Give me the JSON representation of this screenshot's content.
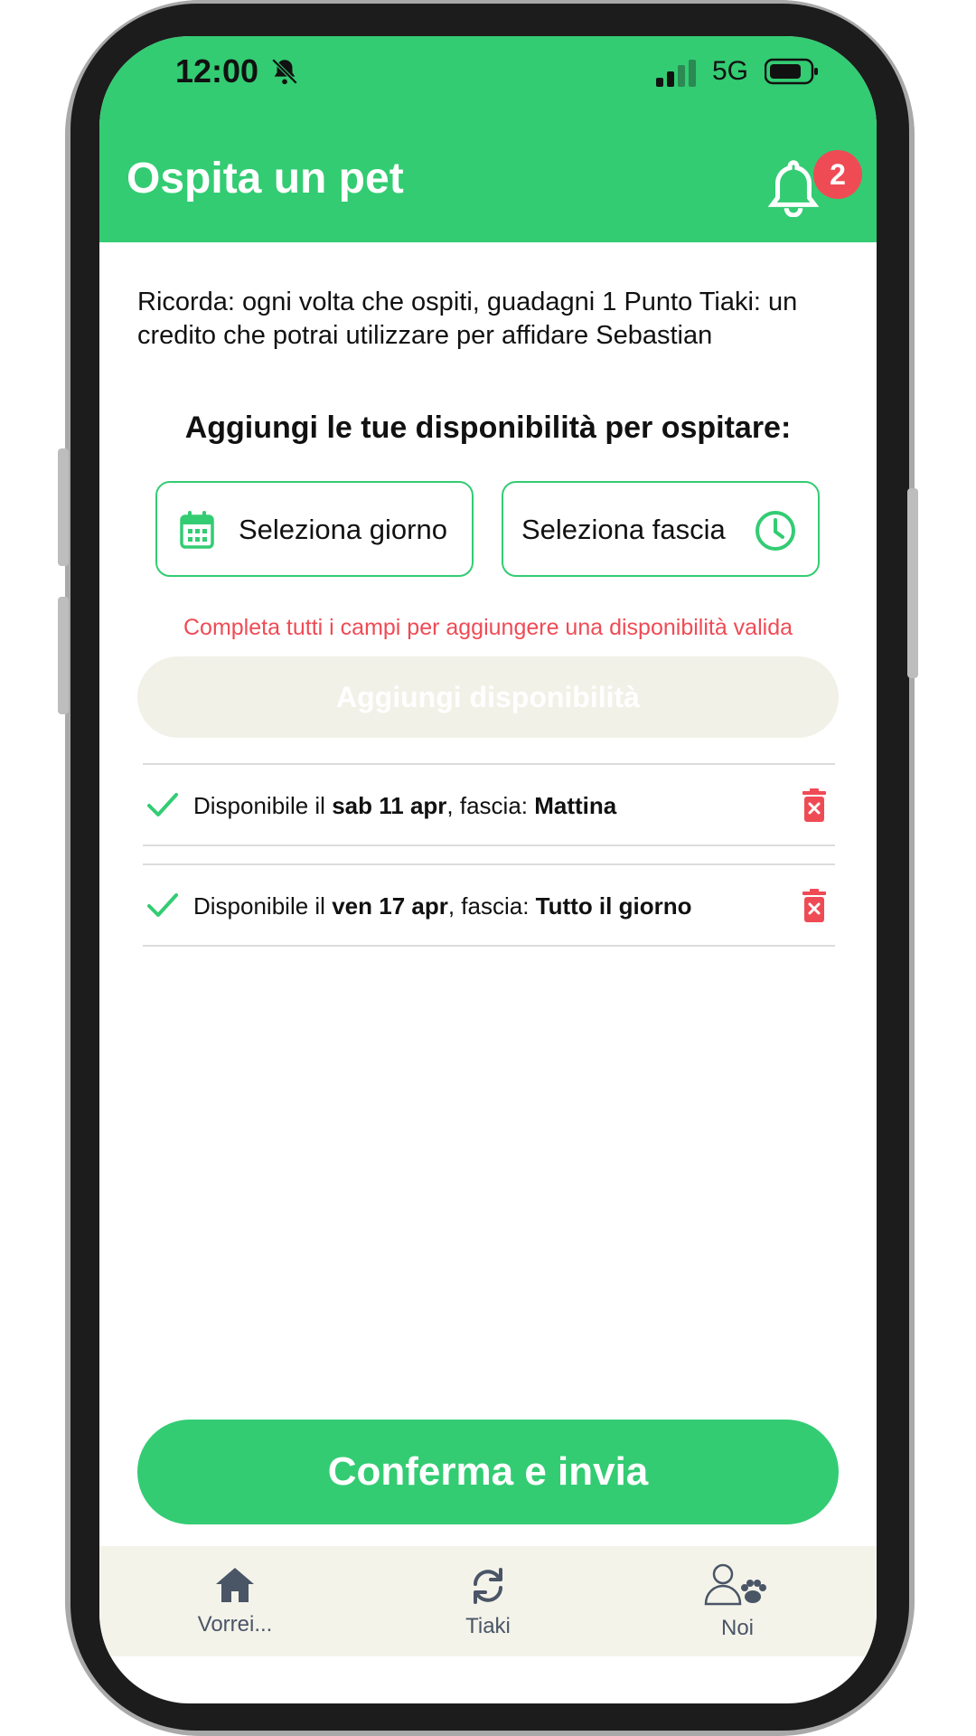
{
  "status_bar": {
    "time": "12:00",
    "network": "5G"
  },
  "header": {
    "title": "Ospita un pet",
    "notification_count": "2"
  },
  "info": {
    "text": "Ricorda: ogni volta che ospiti, guadagni 1 Punto Tiaki: un credito che potrai utilizzare per affidare Sebastian"
  },
  "availability": {
    "section_title": "Aggiungi le tue disponibilità per ospitare:",
    "day_placeholder": "Seleziona giorno",
    "slot_placeholder": "Seleziona fascia",
    "error": "Completa tutti i campi per aggiungere una disponibilità valida",
    "add_button": "Aggiungi disponibilità"
  },
  "entries": [
    {
      "prefix": "Disponibile il",
      "date": "sab 11 apr",
      "mid": ", fascia:",
      "slot": "Mattina"
    },
    {
      "prefix": "Disponibile il",
      "date": "ven 17 apr",
      "mid": ", fascia:",
      "slot": "Tutto il giorno"
    }
  ],
  "confirm_button": "Conferma e invia",
  "tabs": [
    {
      "label": "Vorrei...",
      "icon": "home-icon"
    },
    {
      "label": "Tiaki",
      "icon": "refresh-icon"
    },
    {
      "label": "Noi",
      "icon": "person-paw-icon"
    }
  ],
  "colors": {
    "primary": "#33cc73",
    "danger": "#ef4b55",
    "tabbar": "#f4f3ea",
    "disabled": "#f2f1e8"
  }
}
